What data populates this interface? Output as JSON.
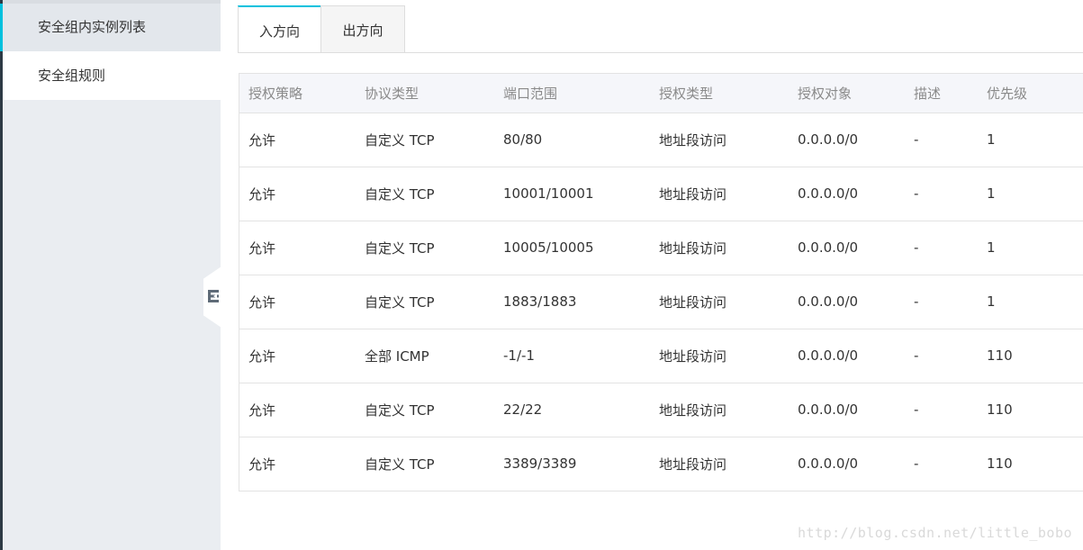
{
  "sidebar": {
    "items": [
      {
        "label": "安全组内实例列表"
      },
      {
        "label": "安全组规则"
      }
    ]
  },
  "tabs": [
    {
      "label": "入方向",
      "active": true
    },
    {
      "label": "出方向",
      "active": false
    }
  ],
  "table": {
    "columns": [
      "授权策略",
      "协议类型",
      "端口范围",
      "授权类型",
      "授权对象",
      "描述",
      "优先级"
    ],
    "rows": [
      [
        "允许",
        "自定义 TCP",
        "80/80",
        "地址段访问",
        "0.0.0.0/0",
        "-",
        "1"
      ],
      [
        "允许",
        "自定义 TCP",
        "10001/10001",
        "地址段访问",
        "0.0.0.0/0",
        "-",
        "1"
      ],
      [
        "允许",
        "自定义 TCP",
        "10005/10005",
        "地址段访问",
        "0.0.0.0/0",
        "-",
        "1"
      ],
      [
        "允许",
        "自定义 TCP",
        "1883/1883",
        "地址段访问",
        "0.0.0.0/0",
        "-",
        "1"
      ],
      [
        "允许",
        "全部 ICMP",
        "-1/-1",
        "地址段访问",
        "0.0.0.0/0",
        "-",
        "110"
      ],
      [
        "允许",
        "自定义 TCP",
        "22/22",
        "地址段访问",
        "0.0.0.0/0",
        "-",
        "110"
      ],
      [
        "允许",
        "自定义 TCP",
        "3389/3389",
        "地址段访问",
        "0.0.0.0/0",
        "-",
        "110"
      ]
    ]
  },
  "collapse_handle": {
    "icon": "collapse-sidebar-icon"
  },
  "watermark": "http://blog.csdn.net/little_bobo",
  "colors": {
    "accent": "#00c1de",
    "sidebar_bg": "#eaedf1",
    "header_bg": "#f5f6fa"
  }
}
